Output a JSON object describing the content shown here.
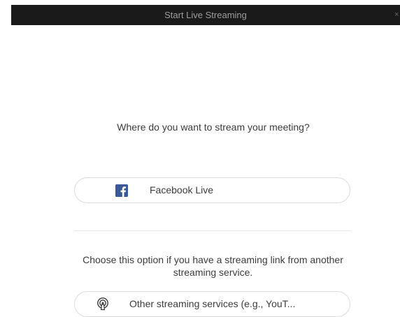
{
  "window": {
    "title": "Start Live Streaming",
    "close_glyph": "×"
  },
  "main": {
    "question": "Where do you want to stream your meeting?",
    "facebook_option": {
      "label": "Facebook Live",
      "icon": "facebook-icon"
    },
    "other_hint": "Choose this option if you have a streaming link from another streaming service.",
    "other_option": {
      "label": "Other streaming services (e.g., YouT...",
      "icon": "live-stream-icon"
    }
  },
  "colors": {
    "titlebar_bg": "#1a1a1a",
    "titlebar_text": "#9d9d9d",
    "facebook_blue": "#3b5998",
    "text": "#3c3c3c",
    "border": "#dcdcdc"
  }
}
